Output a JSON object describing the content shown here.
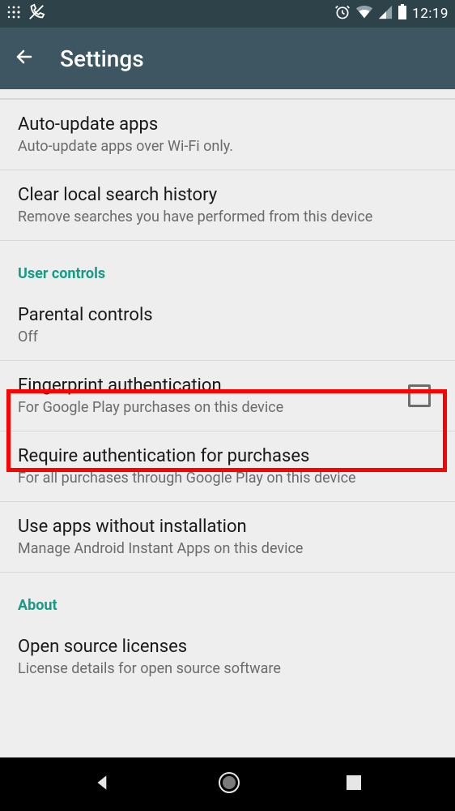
{
  "status": {
    "time": "12:19"
  },
  "header": {
    "title": "Settings"
  },
  "rows": {
    "autoupdate": {
      "title": "Auto-update apps",
      "subtitle": "Auto-update apps over Wi-Fi only."
    },
    "clearhistory": {
      "title": "Clear local search history",
      "subtitle": "Remove searches you have performed from this device"
    },
    "parental": {
      "title": "Parental controls",
      "subtitle": "Off"
    },
    "fingerprint": {
      "title": "Fingerprint authentication",
      "subtitle": "For Google Play purchases on this device",
      "checked": false
    },
    "requireauth": {
      "title": "Require authentication for purchases",
      "subtitle": "For all purchases through Google Play on this device"
    },
    "instant": {
      "title": "Use apps without installation",
      "subtitle": "Manage Android Instant Apps on this device"
    },
    "licenses": {
      "title": "Open source licenses",
      "subtitle": "License details for open source software"
    }
  },
  "sections": {
    "user_controls": "User controls",
    "about": "About"
  }
}
